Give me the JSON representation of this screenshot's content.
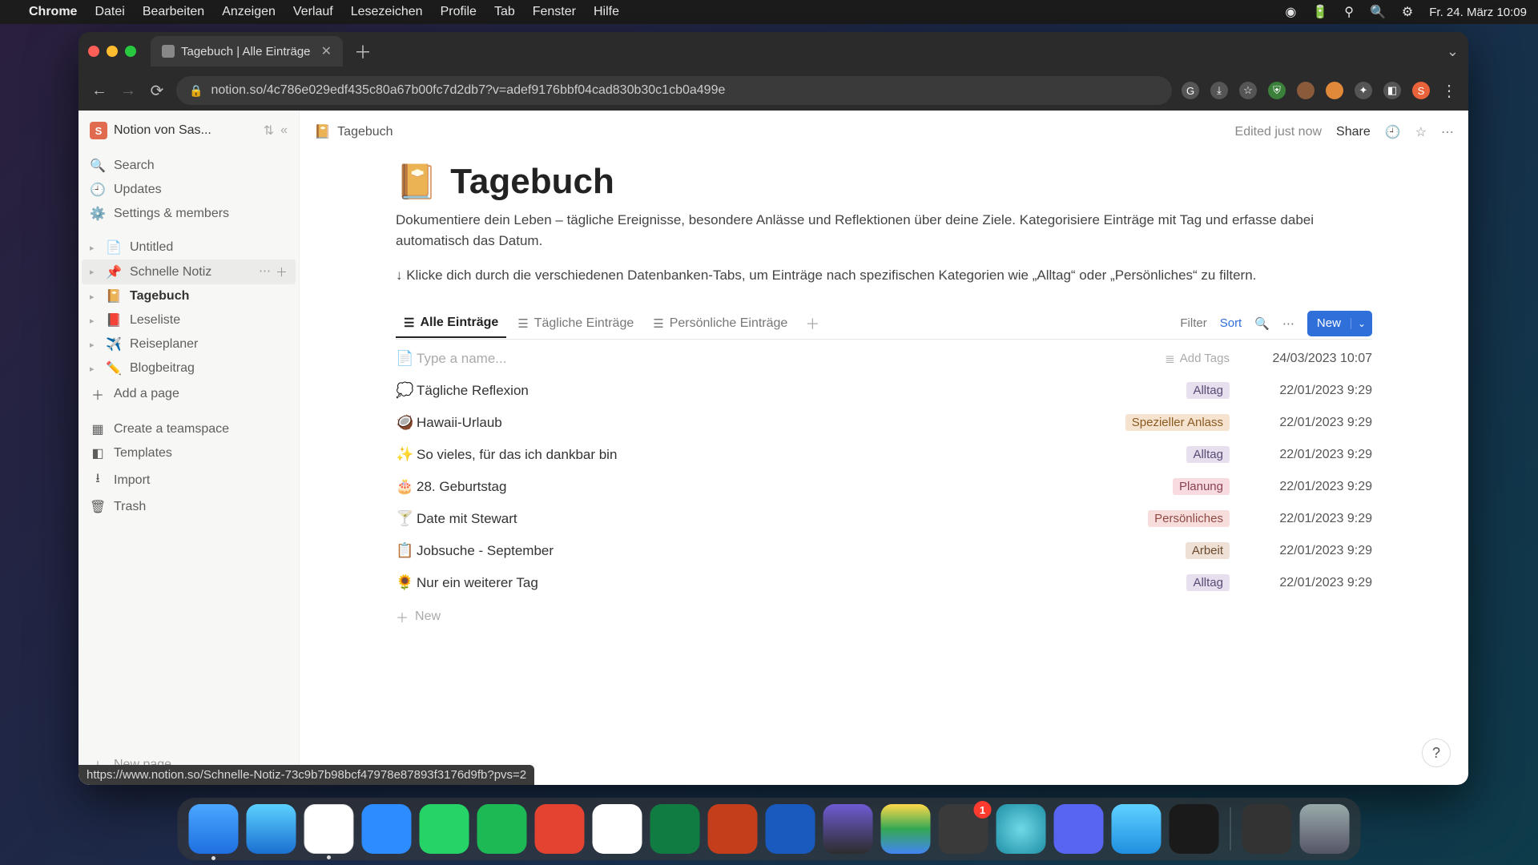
{
  "menubar": {
    "app": "Chrome",
    "items": [
      "Datei",
      "Bearbeiten",
      "Anzeigen",
      "Verlauf",
      "Lesezeichen",
      "Profile",
      "Tab",
      "Fenster",
      "Hilfe"
    ],
    "clock": "Fr. 24. März  10:09"
  },
  "browser": {
    "tab_title": "Tagebuch | Alle Einträge",
    "url": "notion.so/4c786e029edf435c80a67b00fc7d2db7?v=adef9176bbf04cad830b30c1cb0a499e",
    "status_url": "https://www.notion.so/Schnelle-Notiz-73c9b7b98bcf47978e87893f3176d9fb?pvs=2"
  },
  "sidebar": {
    "workspace": "Notion von Sas...",
    "search": "Search",
    "updates": "Updates",
    "settings": "Settings & members",
    "pages": [
      {
        "emoji": "",
        "label": "Untitled",
        "doc": true
      },
      {
        "emoji": "📌",
        "label": "Schnelle Notiz",
        "hover": true
      },
      {
        "emoji": "📔",
        "label": "Tagebuch",
        "selected": true
      },
      {
        "emoji": "📕",
        "label": "Leseliste"
      },
      {
        "emoji": "✈️",
        "label": "Reiseplaner"
      },
      {
        "emoji": "✏️",
        "label": "Blogbeitrag"
      }
    ],
    "add_page": "Add a page",
    "teamspace": "Create a teamspace",
    "templates": "Templates",
    "import": "Import",
    "trash": "Trash",
    "new_page": "New page"
  },
  "topbar": {
    "breadcrumb_emoji": "📔",
    "breadcrumb": "Tagebuch",
    "edited": "Edited just now",
    "share": "Share"
  },
  "page": {
    "emoji": "📔",
    "title": "Tagebuch",
    "desc": "Dokumentiere dein Leben – tägliche Ereignisse, besondere Anlässe und Reflektionen über deine Ziele. Kategorisiere Einträge mit Tag und erfasse dabei automatisch das Datum.",
    "hint": "↓ Klicke dich durch die verschiedenen Datenbanken-Tabs, um Einträge nach spezifischen Kategorien wie „Alltag“ oder „Persönliches“ zu filtern."
  },
  "db": {
    "tabs": [
      {
        "label": "Alle Einträge",
        "active": true
      },
      {
        "label": "Tägliche Einträge"
      },
      {
        "label": "Persönliche Einträge"
      }
    ],
    "filter": "Filter",
    "sort": "Sort",
    "new": "New",
    "add_tags": "Add Tags",
    "placeholder": "Type a name...",
    "newrow": "New",
    "rows": [
      {
        "emoji": "",
        "title": "",
        "date": "24/03/2023 10:07",
        "first": true
      },
      {
        "emoji": "💭",
        "title": "Tägliche Reflexion",
        "tag": "Alltag",
        "tagc": "purple",
        "date": "22/01/2023 9:29"
      },
      {
        "emoji": "🥥",
        "title": "Hawaii-Urlaub",
        "tag": "Spezieller Anlass",
        "tagc": "orange",
        "date": "22/01/2023 9:29"
      },
      {
        "emoji": "✨",
        "title": "So vieles, für das ich dankbar bin",
        "tag": "Alltag",
        "tagc": "purple",
        "date": "22/01/2023 9:29"
      },
      {
        "emoji": "🎂",
        "title": "28. Geburtstag",
        "tag": "Planung",
        "tagc": "pink",
        "date": "22/01/2023 9:29"
      },
      {
        "emoji": "🍸",
        "title": "Date mit Stewart",
        "tag": "Persönliches",
        "tagc": "salmon",
        "date": "22/01/2023 9:29"
      },
      {
        "emoji": "📋",
        "title": "Jobsuche - September",
        "tag": "Arbeit",
        "tagc": "brown",
        "date": "22/01/2023 9:29"
      },
      {
        "emoji": "🌻",
        "title": "Nur ein weiterer Tag",
        "tag": "Alltag",
        "tagc": "purple",
        "date": "22/01/2023 9:29"
      }
    ]
  },
  "dock": {
    "badge_index": 13,
    "badge_value": "1"
  }
}
